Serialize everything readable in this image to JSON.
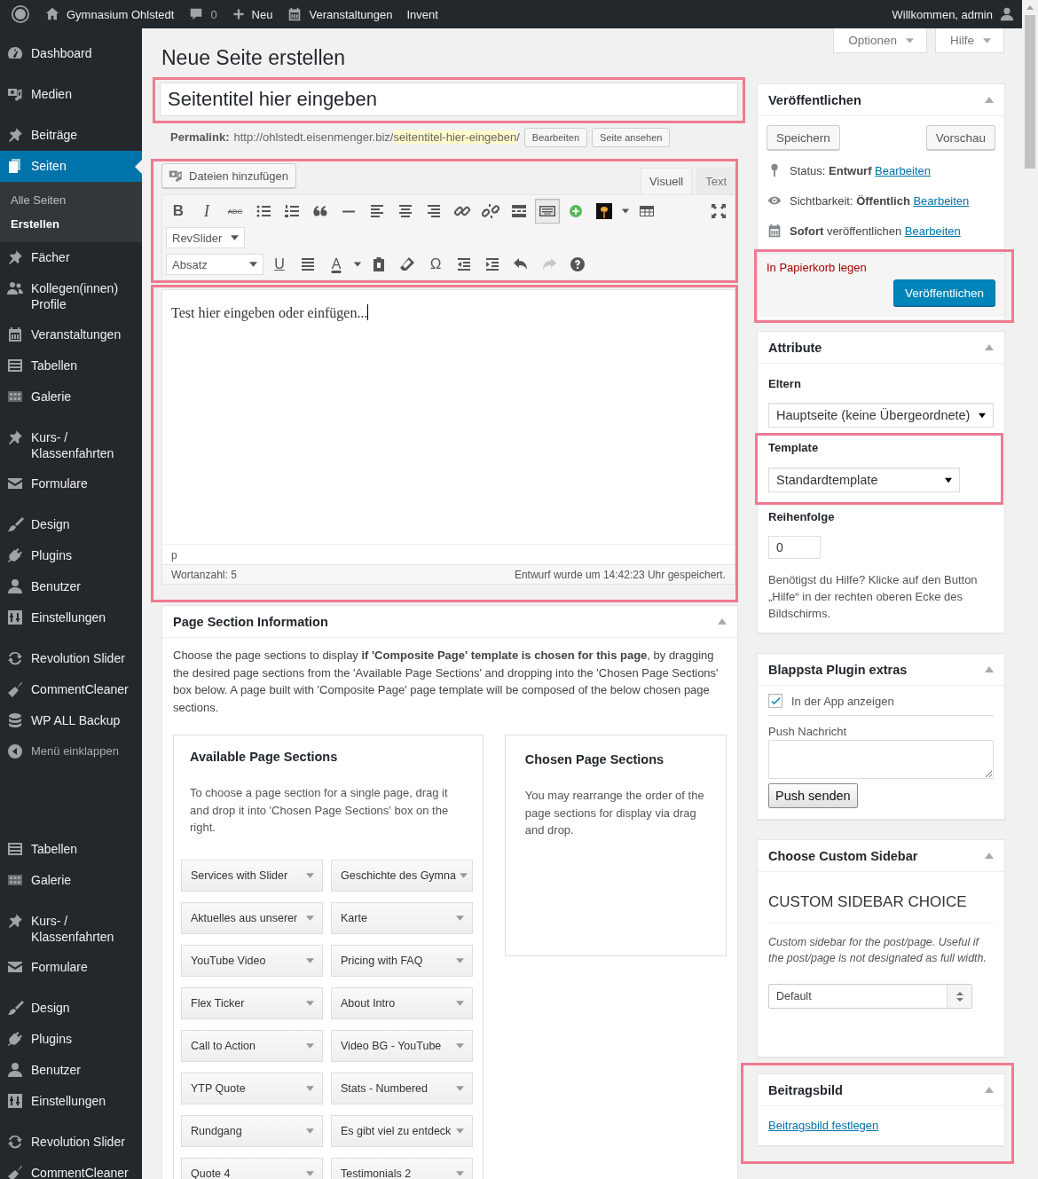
{
  "admin_bar": {
    "site": "Gymnasium Ohlstedt",
    "comments": "0",
    "new": "Neu",
    "events": "Veranstaltungen",
    "theme": "Invent",
    "account": "Willkommen, admin"
  },
  "sidebar": {
    "items": [
      {
        "kind": "item",
        "label": "Dashboard",
        "selected": false
      },
      {
        "kind": "separator"
      },
      {
        "kind": "item",
        "label": "Medien",
        "selected": false
      },
      {
        "kind": "separator"
      },
      {
        "kind": "item",
        "label": "Beiträge",
        "selected": false
      },
      {
        "kind": "item",
        "label": "Seiten",
        "selected": true,
        "children": [
          {
            "label": "Alle Seiten",
            "selected": false
          },
          {
            "label": "Erstellen",
            "selected": true
          }
        ]
      },
      {
        "kind": "item",
        "label": "Fächer",
        "selected": false
      },
      {
        "kind": "item",
        "label": "Kollegen(innen) Profile",
        "selected": false
      },
      {
        "kind": "item",
        "label": "Veranstaltungen",
        "selected": false
      },
      {
        "kind": "item",
        "label": "Tabellen",
        "selected": false
      },
      {
        "kind": "item",
        "label": "Galerie",
        "selected": false
      },
      {
        "kind": "separator"
      },
      {
        "kind": "item",
        "label": "Kurs- / Klassenfahrten",
        "selected": false
      },
      {
        "kind": "item",
        "label": "Formulare",
        "selected": false
      },
      {
        "kind": "separator"
      },
      {
        "kind": "item",
        "label": "Design",
        "selected": false
      },
      {
        "kind": "item",
        "label": "Plugins",
        "selected": false
      },
      {
        "kind": "item",
        "label": "Benutzer",
        "selected": false
      },
      {
        "kind": "item",
        "label": "Einstellungen",
        "selected": false
      },
      {
        "kind": "separator"
      },
      {
        "kind": "item",
        "label": "Revolution Slider",
        "selected": false
      },
      {
        "kind": "item",
        "label": "CommentCleaner",
        "selected": false
      },
      {
        "kind": "item",
        "label": "WP ALL Backup",
        "selected": false
      },
      {
        "kind": "collapse",
        "label": "Menü einklappen"
      },
      {
        "kind": "blank"
      },
      {
        "kind": "item",
        "label": "Tabellen",
        "selected": false
      },
      {
        "kind": "item",
        "label": "Galerie",
        "selected": false
      },
      {
        "kind": "separator"
      },
      {
        "kind": "item",
        "label": "Kurs- / Klassenfahrten",
        "selected": false
      },
      {
        "kind": "item",
        "label": "Formulare",
        "selected": false
      },
      {
        "kind": "separator"
      },
      {
        "kind": "item",
        "label": "Design",
        "selected": false
      },
      {
        "kind": "item",
        "label": "Plugins",
        "selected": false
      },
      {
        "kind": "item",
        "label": "Benutzer",
        "selected": false
      },
      {
        "kind": "item",
        "label": "Einstellungen",
        "selected": false
      },
      {
        "kind": "separator"
      },
      {
        "kind": "item",
        "label": "Revolution Slider",
        "selected": false
      },
      {
        "kind": "item",
        "label": "CommentCleaner",
        "selected": false
      }
    ]
  },
  "page_title": "Neue Seite erstellen",
  "screen_options": [
    {
      "label": "Optionen"
    },
    {
      "label": "Hilfe"
    }
  ],
  "title_field": {
    "placeholder": "Seitentitel hier eingeben",
    "highlighted": true
  },
  "permalink": {
    "label": "Permalink:",
    "base": "http://ohlstedt.eisenmenger.biz/",
    "slug": "seitentitel-hier-eingeben",
    "end": "/",
    "buttons": [
      "Bearbeiten",
      "Seite ansehen"
    ]
  },
  "editor": {
    "add_media": "Dateien hinzufügen",
    "tabs": [
      {
        "label": "Visuell",
        "selected": true
      },
      {
        "label": "Text",
        "selected": false
      }
    ],
    "toolbar": {
      "highlighted": true,
      "rows": [
        [
          {
            "kind": "glyph",
            "text": "B",
            "pressed": false
          },
          {
            "kind": "glyph",
            "text": "I",
            "pressed": false
          },
          {
            "kind": "glyph",
            "text": "ABC",
            "pressed": false
          },
          {
            "kind": "icon",
            "pressed": false
          },
          {
            "kind": "icon",
            "pressed": false
          },
          {
            "kind": "icon",
            "pressed": false
          },
          {
            "kind": "icon",
            "pressed": false
          },
          {
            "kind": "icon",
            "pressed": false
          },
          {
            "kind": "icon",
            "pressed": false
          },
          {
            "kind": "icon",
            "pressed": false
          },
          {
            "kind": "icon",
            "pressed": false
          },
          {
            "kind": "icon",
            "pressed": false
          },
          {
            "kind": "icon",
            "pressed": false
          },
          {
            "kind": "icon",
            "pressed": true
          },
          {
            "kind": "icon",
            "pressed": false
          },
          {
            "kind": "icon",
            "pressed": false
          },
          {
            "kind": "icon",
            "pressed": false
          },
          {
            "kind": "icon",
            "pressed": false
          },
          {
            "kind": "icon",
            "pressed": false
          }
        ],
        [
          {
            "kind": "select",
            "text": "RevSlider"
          }
        ],
        [
          {
            "kind": "select",
            "text": "Absatz"
          },
          {
            "kind": "glyph",
            "text": "U",
            "pressed": false
          },
          {
            "kind": "icon",
            "pressed": false
          },
          {
            "kind": "glyph",
            "text": "A",
            "pressed": false
          },
          {
            "kind": "icon",
            "pressed": false
          },
          {
            "kind": "icon",
            "pressed": false
          },
          {
            "kind": "icon",
            "pressed": false
          },
          {
            "kind": "glyph",
            "text": "Ω",
            "pressed": false
          },
          {
            "kind": "icon",
            "pressed": false
          },
          {
            "kind": "icon",
            "pressed": false
          },
          {
            "kind": "icon",
            "pressed": false
          },
          {
            "kind": "icon",
            "pressed": false
          },
          {
            "kind": "icon",
            "pressed": false
          }
        ]
      ]
    },
    "content": {
      "text": "Test hier eingeben oder einfügen...",
      "highlighted": true
    },
    "path": "p",
    "word_count": "Wortanzahl: 5",
    "saved": "Entwurf wurde um 14:42:23 Uhr gespeichert."
  },
  "page_sections": {
    "title": "Page Section Information",
    "description": "Choose the page sections to display **if 'Composite Page' template is chosen for this page**, by dragging the desired page sections from the 'Available Page Sections' and dropping into the 'Chosen Page Sections' box below. A page built with 'Composite Page' page template will be composed of the below chosen page sections.",
    "available": {
      "title": "Available Page Sections",
      "text": "To choose a page section for a single page, drag it and drop it into 'Chosen Page Sections' box on the right.",
      "items": [
        "Services with Slider",
        "Geschichte des Gymna",
        "Aktuelles aus unserer",
        "Karte",
        "YouTube Video",
        "Pricing with FAQ",
        "Flex Ticker",
        "About Intro",
        "Call to Action",
        "Video BG - YouTube",
        "YTP Quote",
        "Stats - Numbered",
        "Rundgang",
        "Es gibt viel zu entdeck",
        "Quote 4",
        "Testimonials 2"
      ]
    },
    "chosen": {
      "title": "Chosen Page Sections",
      "text": "You may rearrange the order of the page sections for display via drag and drop."
    }
  },
  "publish": {
    "title": "Veröffentlichen",
    "save": "Speichern",
    "preview": "Vorschau",
    "settings": [
      {
        "text": "Status: **Entwurf**",
        "link": "Bearbeiten"
      },
      {
        "text": "Sichtbarkeit: **Öffentlich**",
        "link": "Bearbeiten"
      },
      {
        "text": "**Sofort** veröffentlichen",
        "link": "Bearbeiten"
      }
    ],
    "actions": {
      "highlighted": true,
      "trash": "In Papierkorb legen",
      "publish": "Veröffentlichen"
    }
  },
  "attributes": {
    "title": "Attribute",
    "parent_label": "Eltern",
    "parent_value": "Hauptseite (keine Übergeordnete)",
    "template_label": "Template",
    "template_value": "Standardtemplate",
    "template_highlighted": true,
    "order_label": "Reihenfolge",
    "order_value": "0",
    "help": "Benötigst du Hilfe? Klicke auf den Button „Hilfe“ in der rechten oberen Ecke des Bildschirms."
  },
  "blappsta": {
    "title": "Blappsta Plugin extras",
    "checkbox": {
      "label": "In der App anzeigen",
      "checked": true
    },
    "push_label": "Push Nachricht",
    "push_button": "Push senden"
  },
  "custom_sidebar": {
    "title": "Choose Custom Sidebar",
    "heading": "CUSTOM SIDEBAR CHOICE",
    "note": "Custom sidebar for the post/page. Useful if the post/page is not designated as full width.",
    "select": "Default"
  },
  "featured_image": {
    "title": "Beitragsbild",
    "link": "Beitragsbild festlegen",
    "highlighted": true
  }
}
